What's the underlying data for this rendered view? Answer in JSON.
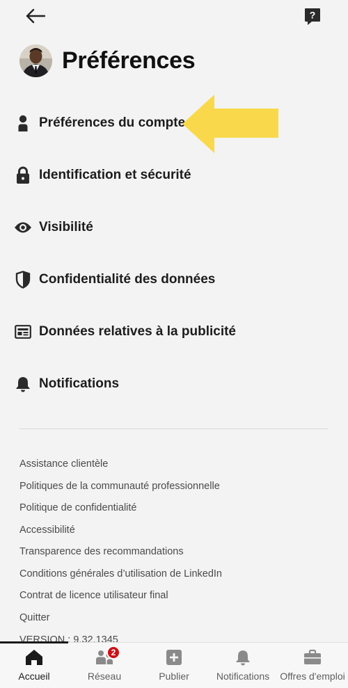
{
  "header": {
    "title": "Préférences"
  },
  "menu": {
    "items": [
      {
        "label": "Préférences du compte",
        "icon": "person-icon"
      },
      {
        "label": "Identification et sécurité",
        "icon": "lock-icon"
      },
      {
        "label": "Visibilité",
        "icon": "eye-icon"
      },
      {
        "label": "Confidentialité des données",
        "icon": "shield-icon"
      },
      {
        "label": "Données relatives à la publicité",
        "icon": "ad-card-icon"
      },
      {
        "label": "Notifications",
        "icon": "bell-icon"
      }
    ]
  },
  "links": {
    "items": [
      "Assistance clientèle",
      "Politiques de la communauté professionnelle",
      "Politique de confidentialité",
      "Accessibilité",
      "Transparence des recommandations",
      "Conditions générales d’utilisation de LinkedIn",
      "Contrat de licence utilisateur final",
      "Quitter"
    ],
    "version": "VERSION : 9.32.1345"
  },
  "bottom_nav": {
    "items": [
      {
        "label": "Accueil",
        "icon": "home-icon",
        "active": true
      },
      {
        "label": "Réseau",
        "icon": "network-icon",
        "badge": "2"
      },
      {
        "label": "Publier",
        "icon": "plus-square-icon"
      },
      {
        "label": "Notifications",
        "icon": "bell-icon"
      },
      {
        "label": "Offres d'emploi",
        "icon": "briefcase-icon"
      }
    ]
  },
  "colors": {
    "background": "#f3f3f3",
    "arrow": "#f9d94b",
    "badge": "#cc1016",
    "text": "#1a1a1a"
  }
}
